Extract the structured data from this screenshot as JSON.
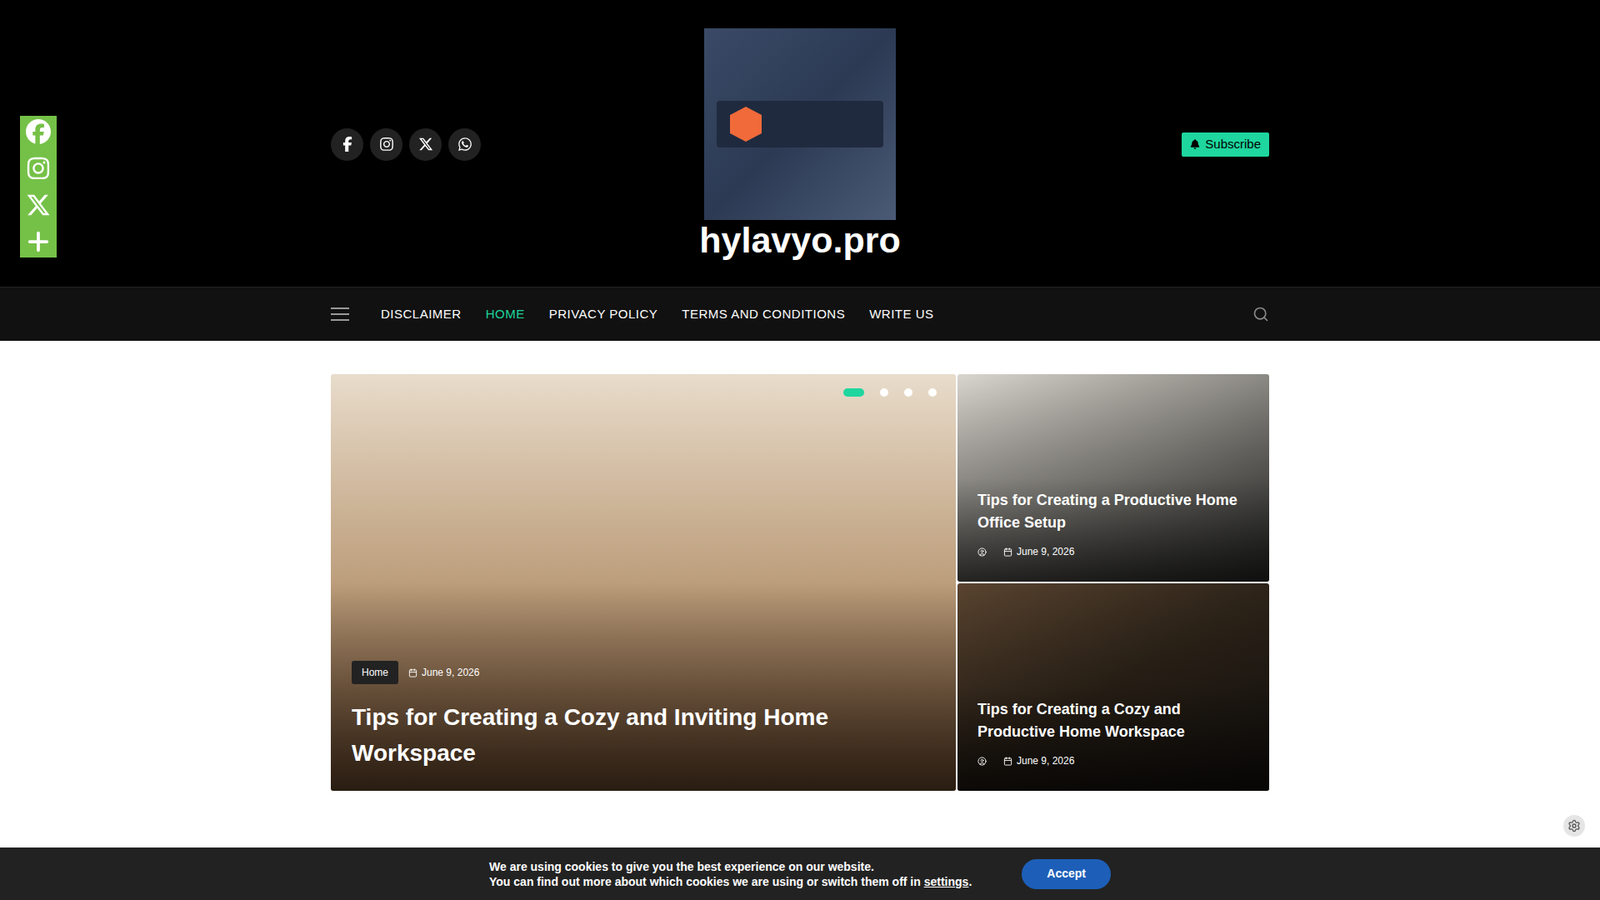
{
  "site": {
    "title": "hylavyo.pro"
  },
  "header_social": [
    {
      "kind": "facebook"
    },
    {
      "kind": "instagram"
    },
    {
      "kind": "x"
    },
    {
      "kind": "whatsapp"
    }
  ],
  "subscribe_button": {
    "label": "Subscribe"
  },
  "nav": {
    "items": [
      {
        "label": "DISCLAIMER",
        "selected": false
      },
      {
        "label": "HOME",
        "selected": true
      },
      {
        "label": "PRIVACY POLICY",
        "selected": false
      },
      {
        "label": "TERMS AND CONDITIONS",
        "selected": false
      },
      {
        "label": "WRITE US",
        "selected": false
      }
    ]
  },
  "share_bar": {
    "items": [
      {
        "kind": "facebook"
      },
      {
        "kind": "instagram"
      },
      {
        "kind": "x"
      },
      {
        "kind": "more"
      }
    ]
  },
  "slider": {
    "dots": [
      {
        "selected": true
      },
      {
        "selected": false
      },
      {
        "selected": false
      },
      {
        "selected": false
      }
    ],
    "slide": {
      "category": "Home",
      "date": "June 9, 2026",
      "title": "Tips for Creating a Cozy and Inviting Home Workspace"
    }
  },
  "side_posts": [
    {
      "title": "Tips for Creating a Productive Home Office Setup",
      "date": "June 9, 2026"
    },
    {
      "title": "Tips for Creating a Cozy and Productive Home Workspace",
      "date": "June 9, 2026"
    }
  ],
  "cookie_notice": {
    "line1": "We are using cookies to give you the best experience on our website.",
    "line2": "You can find out more about which cookies we are using or switch them off in ",
    "link": "settings",
    "after": ".",
    "accept": "Accept"
  }
}
